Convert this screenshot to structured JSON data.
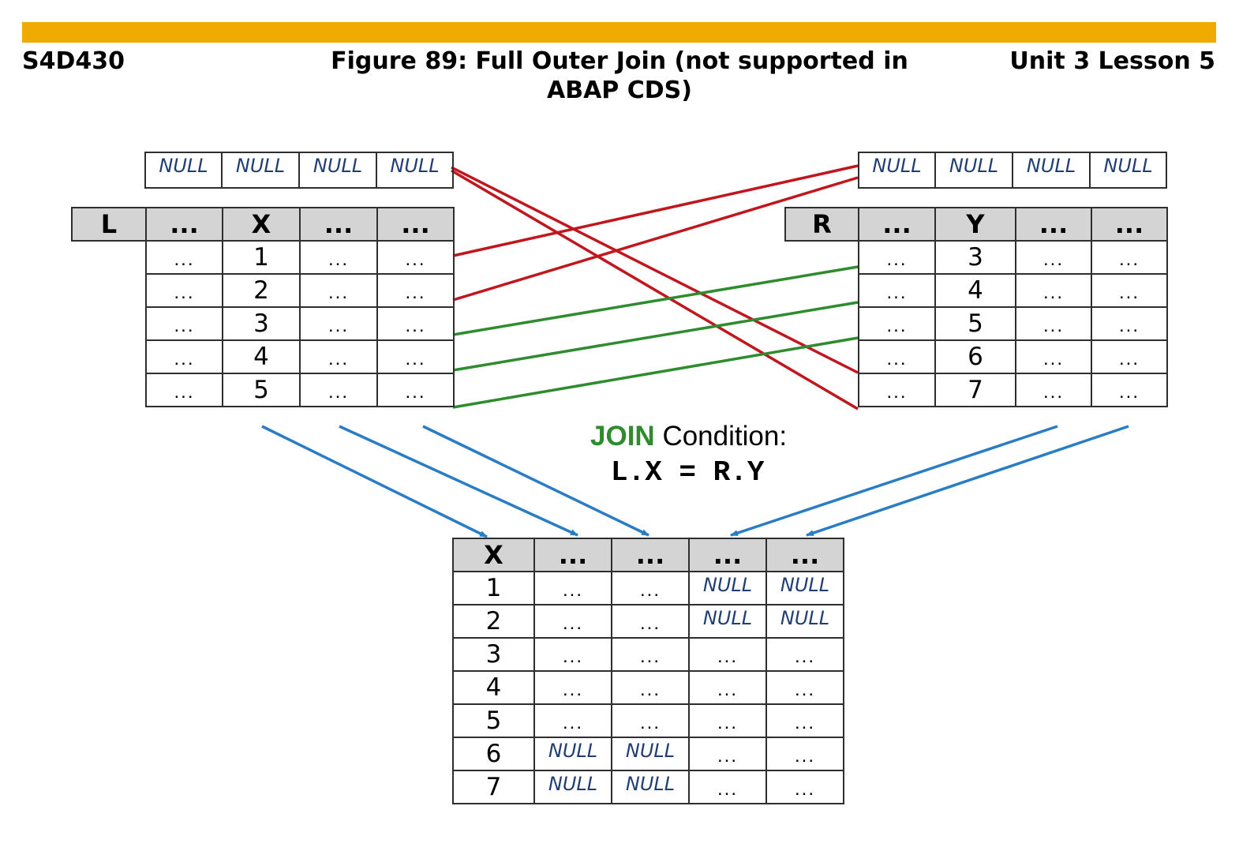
{
  "header": {
    "left": "S4D430",
    "title": "Figure 89: Full Outer Join (not supported in ABAP CDS)",
    "right": "Unit 3 Lesson 5"
  },
  "colors": {
    "top_bar": "#f0ab00",
    "unmatched_link": "#c0161e",
    "matched_link": "#2e8b2e",
    "flow_arrow": "#2a7dc4",
    "header_cell": "#d4d4d4",
    "null_text": "#213e73"
  },
  "left_table": {
    "name": "L",
    "columns": [
      "...",
      "X",
      "...",
      "..."
    ],
    "rows": [
      [
        "...",
        "1",
        "...",
        "..."
      ],
      [
        "...",
        "2",
        "...",
        "..."
      ],
      [
        "...",
        "3",
        "...",
        "..."
      ],
      [
        "...",
        "4",
        "...",
        "..."
      ],
      [
        "...",
        "5",
        "...",
        "..."
      ]
    ]
  },
  "right_table": {
    "name": "R",
    "columns": [
      "...",
      "Y",
      "...",
      "..."
    ],
    "rows": [
      [
        "...",
        "3",
        "...",
        "..."
      ],
      [
        "...",
        "4",
        "...",
        "..."
      ],
      [
        "...",
        "5",
        "...",
        "..."
      ],
      [
        "...",
        "6",
        "...",
        "..."
      ],
      [
        "...",
        "7",
        "...",
        "..."
      ]
    ]
  },
  "null_row": [
    "NULL",
    "NULL",
    "NULL",
    "NULL"
  ],
  "join_condition": {
    "keyword": "JOIN",
    "label": "Condition:",
    "expression": "L.X = R.Y"
  },
  "result_table": {
    "columns": [
      "X",
      "...",
      "...",
      "...",
      "..."
    ],
    "rows": [
      [
        "1",
        "...",
        "...",
        "NULL",
        "NULL"
      ],
      [
        "2",
        "...",
        "...",
        "NULL",
        "NULL"
      ],
      [
        "3",
        "...",
        "...",
        "...",
        "..."
      ],
      [
        "4",
        "...",
        "...",
        "...",
        "..."
      ],
      [
        "5",
        "...",
        "...",
        "...",
        "..."
      ],
      [
        "6",
        "NULL",
        "NULL",
        "...",
        "..."
      ],
      [
        "7",
        "NULL",
        "NULL",
        "...",
        "..."
      ]
    ]
  }
}
